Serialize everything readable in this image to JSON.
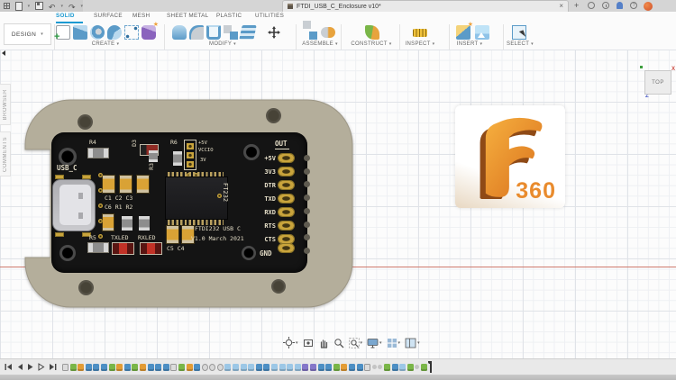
{
  "window": {
    "title": "FTDI_USB_C_Enclosure v10*",
    "close_label": "×",
    "new_tab_label": "+",
    "qat_icons": [
      "data-panel",
      "file",
      "save",
      "undo",
      "redo"
    ],
    "right_icons": [
      "job-status",
      "recent",
      "notifications",
      "help",
      "profile"
    ]
  },
  "toolbar": {
    "workspace_label": "DESIGN",
    "tabs": [
      "SOLID",
      "SURFACE",
      "MESH",
      "SHEET METAL",
      "PLASTIC",
      "UTILITIES"
    ],
    "active_tab": "SOLID",
    "groups": [
      {
        "label": "CREATE",
        "tools": [
          "create-sketch",
          "extrude",
          "revolve",
          "sweep",
          "pattern",
          "form"
        ]
      },
      {
        "label": "MODIFY",
        "tools": [
          "press-pull",
          "fillet",
          "shell",
          "combine",
          "offset",
          "move"
        ]
      },
      {
        "label": "ASSEMBLE",
        "tools": [
          "new-component",
          "joint"
        ]
      },
      {
        "label": "CONSTRUCT",
        "tools": [
          "construction-plane"
        ]
      },
      {
        "label": "INSPECT",
        "tools": [
          "measure"
        ]
      },
      {
        "label": "INSERT",
        "tools": [
          "insert-derive",
          "insert-canvas"
        ]
      },
      {
        "label": "SELECT",
        "tools": [
          "select"
        ]
      }
    ]
  },
  "side_panel": {
    "tabs": [
      "BROWSER",
      "COMMENTS"
    ]
  },
  "viewcube": {
    "face": "TOP",
    "axis_x": "X",
    "axis_z": "Z"
  },
  "canvas": {
    "axis_x_color": "#cf7a6e",
    "grid_minor": "#eef0f3",
    "grid_major": "#e0e3e8"
  },
  "board": {
    "connector_label": "USB_C",
    "refdes": {
      "r4": "R4",
      "r5": "R5",
      "r6": "R6",
      "r3": "R3",
      "d3": "D3",
      "caps_row": "C1 C2 C3",
      "mid_row": "C6 R1 R2",
      "c5c4": "C5 C4",
      "txled": "TXLED",
      "rxled": "RXLED"
    },
    "jumper_labels": [
      "+5V",
      "VCCIO",
      "3V"
    ],
    "chip_label": "FT232",
    "title_line1": "FTDI232 USB C",
    "title_line2": "V1.0 March 2021",
    "header_label": "OUT",
    "gnd_label": "GND",
    "pins": [
      "+5V",
      "3V3",
      "DTR",
      "TXD",
      "RXD",
      "RTS",
      "CTS"
    ],
    "colors": {
      "pcb": "#141414",
      "silkscreen": "#e3dcc6",
      "gold": "#c9a43c",
      "enclosure": "#b4ae9b"
    }
  },
  "logo": {
    "label": "360",
    "color": "#e98b2d"
  },
  "navbar": {
    "items": [
      "orbit",
      "look-at",
      "pan",
      "zoom",
      "fit",
      "display-settings",
      "grid-settings",
      "viewports"
    ]
  },
  "timeline": {
    "controls": [
      "skip-start",
      "step-back",
      "play",
      "step-forward",
      "skip-end"
    ],
    "palette": {
      "gray": "#dcdcdc",
      "green": "#7ab648",
      "orange": "#e39c35",
      "blue": "#4d8fc4",
      "lblue": "#9cc7e6",
      "purple": "#8577c9",
      "circle": "#d9d9d9",
      "small": "#c4c4c4"
    },
    "features": [
      "gray",
      "green",
      "orange",
      "blue",
      "blue",
      "blue",
      "green",
      "orange",
      "blue",
      "green",
      "orange",
      "blue",
      "blue",
      "blue",
      "gray",
      "green",
      "orange",
      "blue",
      "circle",
      "circle",
      "circle",
      "lblue",
      "lblue",
      "lblue",
      "lblue",
      "blue",
      "blue",
      "lblue",
      "lblue",
      "lblue",
      "lblue",
      "purple",
      "purple",
      "blue",
      "blue",
      "green",
      "orange",
      "blue",
      "blue",
      "gray",
      "small",
      "small",
      "green",
      "blue",
      "lblue",
      "green",
      "small",
      "green"
    ]
  }
}
